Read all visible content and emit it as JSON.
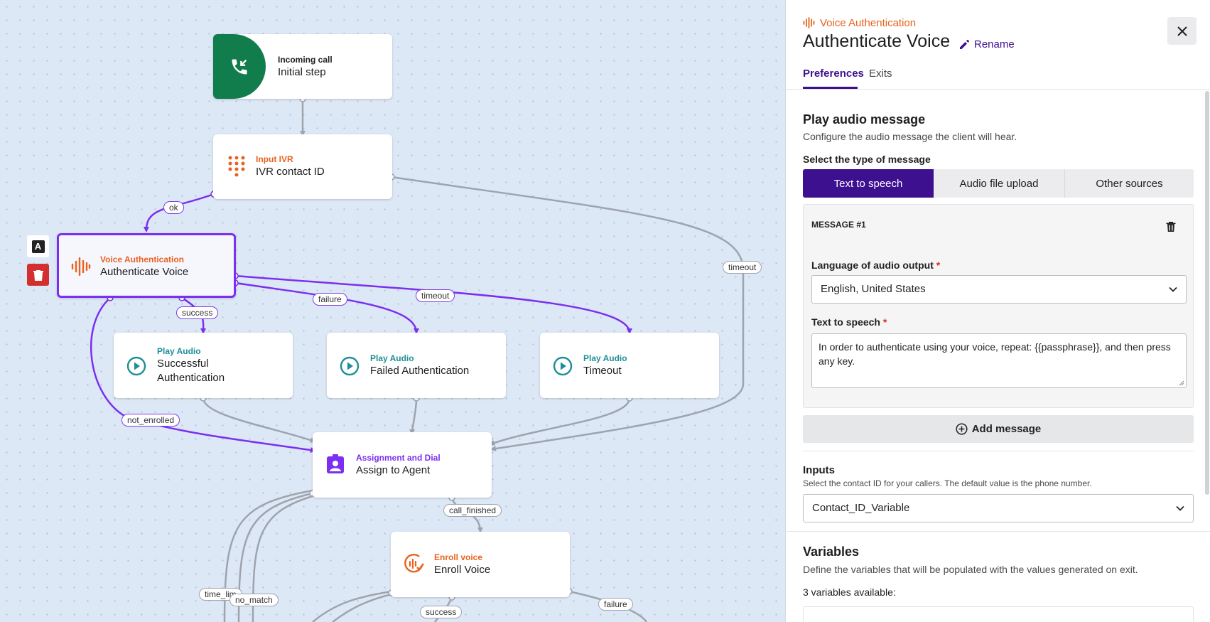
{
  "canvas": {
    "nodes": {
      "incoming": {
        "kind": "Incoming call",
        "title": "Initial step"
      },
      "ivr": {
        "kind": "Input IVR",
        "title": "IVR contact ID"
      },
      "voice_auth": {
        "kind": "Voice Authentication",
        "title": "Authenticate Voice"
      },
      "play_success": {
        "kind": "Play Audio",
        "title_line1": "Successful",
        "title_line2": "Authentication"
      },
      "play_failed": {
        "kind": "Play Audio",
        "title": "Failed Authentication"
      },
      "play_timeout": {
        "kind": "Play Audio",
        "title": "Timeout"
      },
      "assign": {
        "kind": "Assignment and Dial",
        "title": "Assign to Agent"
      },
      "enroll": {
        "kind": "Enroll voice",
        "title": "Enroll Voice"
      }
    },
    "edge_labels": {
      "ok": "ok",
      "timeout_ivr": "timeout",
      "success": "success",
      "failure": "failure",
      "timeout": "timeout",
      "not_enrolled": "not_enrolled",
      "call_finished": "call_finished",
      "no_match": "no_match",
      "time_limit": "time_lim",
      "enroll_success": "success",
      "enroll_failure": "failure"
    },
    "tools": {
      "text_label": "A"
    }
  },
  "panel": {
    "node_kind": "Voice Authentication",
    "node_title": "Authenticate Voice",
    "rename_label": "Rename",
    "tabs": [
      "Preferences",
      "Exits"
    ],
    "active_tab": "Preferences",
    "play_audio": {
      "heading": "Play audio message",
      "description": "Configure the audio message the client will hear.",
      "type_label": "Select the type of message",
      "types": [
        "Text to speech",
        "Audio file upload",
        "Other sources"
      ],
      "selected_type": "Text to speech"
    },
    "message": {
      "header": "MESSAGE #1",
      "language_label": "Language of audio output",
      "language_value": "English, United States",
      "tts_label": "Text to speech",
      "tts_value": "In order to authenticate using your voice, repeat: {{passphrase}}, and then press any key."
    },
    "add_message_label": "Add message",
    "inputs": {
      "heading": "Inputs",
      "description": "Select the contact ID for your callers. The default value is the phone number.",
      "value": "Contact_ID_Variable"
    },
    "variables": {
      "heading": "Variables",
      "description": "Define the variables that will be populated with the values generated on exit.",
      "count_text": "3 variables available:"
    },
    "colors": {
      "primary": "#3d1090",
      "accent_purple": "#7b2ff0",
      "orange": "#e8621f",
      "teal": "#1e8f97",
      "green": "#127d4c",
      "danger": "#d32f2f"
    }
  }
}
